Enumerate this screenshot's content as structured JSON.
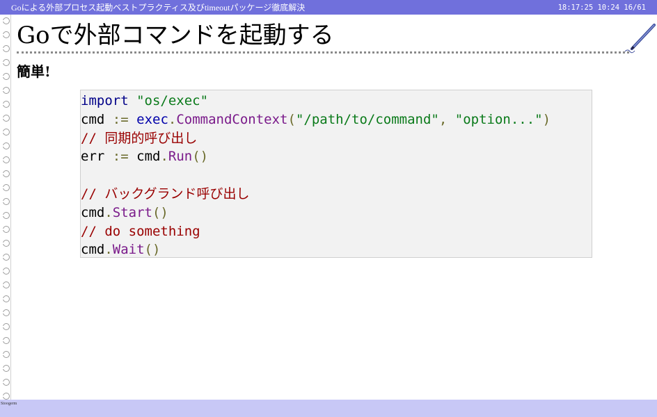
{
  "topbar": {
    "title": "Goによる外部プロセス起動ベストプラクティス及びtimeoutパッケージ徹底解決",
    "status": "18:17:25 10:24 16/61"
  },
  "slide": {
    "title": "Goで外部コマンドを起動する",
    "heading": "簡単!"
  },
  "code": {
    "line1": {
      "keyword": "import",
      "string": "\"os/exec\""
    },
    "line2": {
      "var": "cmd",
      "op": ":=",
      "pkg": "exec",
      "dot": ".",
      "func": "CommandContext",
      "open": "(",
      "arg1": "\"/path/to/command\"",
      "comma": ",",
      "arg2": "\"option...\"",
      "close": ")"
    },
    "line3": {
      "comment": "// 同期的呼び出し"
    },
    "line4": {
      "var": "err",
      "op": ":=",
      "obj": "cmd",
      "dot": ".",
      "func": "Run",
      "parens": "()"
    },
    "line6": {
      "comment": "// バックグランド呼び出し"
    },
    "line7": {
      "obj": "cmd",
      "dot": ".",
      "func": "Start",
      "parens": "()"
    },
    "line8": {
      "comment": "// do something"
    },
    "line9": {
      "obj": "cmd",
      "dot": ".",
      "func": "Wait",
      "parens": "()"
    }
  },
  "footer": {
    "label": "Stoogerm"
  },
  "colors": {
    "topbar": "#7070dc",
    "bottombar": "#c8c8f6",
    "code_background": "#f2f2f2",
    "comment": "#990000",
    "string": "#0a7a1a",
    "function": "#7a1a8a"
  },
  "icons": {
    "corner": "pen-icon",
    "binding": "notebook-ring-icon"
  }
}
